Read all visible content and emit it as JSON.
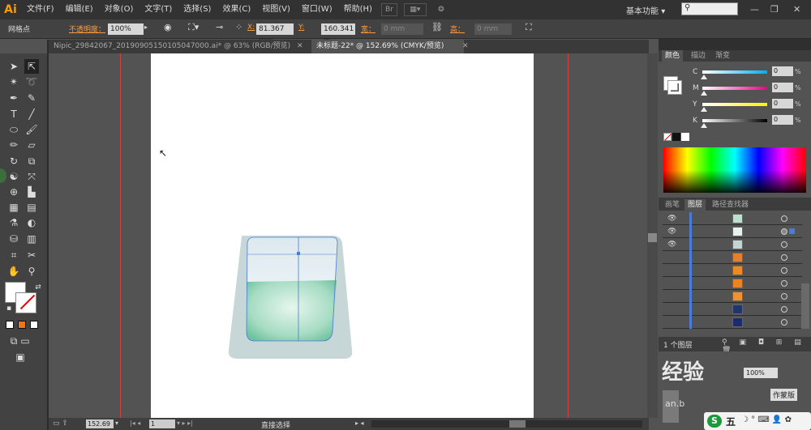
{
  "app": {
    "logo": "Ai"
  },
  "menu": [
    "文件(F)",
    "编辑(E)",
    "对象(O)",
    "文字(T)",
    "选择(S)",
    "效果(C)",
    "视图(V)",
    "窗口(W)",
    "帮助(H)"
  ],
  "menubar_extra": {
    "br": "Br",
    "workspace": "基本功能",
    "workspace_arrow": "▾"
  },
  "window_controls": [
    "—",
    "❐",
    "✕"
  ],
  "control": {
    "mode": "网格点",
    "opacity_label": "不透明度：",
    "opacity_value": "100%",
    "x_label": "X:",
    "x_value": "81.367 mm",
    "y_label": "Y:",
    "y_value": "160.341 m",
    "w_label": "宽：",
    "w_value": "0 mm",
    "h_label": "高：",
    "h_value": "0 mm"
  },
  "tabs": [
    {
      "label": "Nipic_29842067_20190905150105047000.ai* @ 63% (RGB/预览)",
      "close": "✕"
    },
    {
      "label": "未标题-22* @ 152.69% (CMYK/预览)",
      "close": "✕"
    }
  ],
  "panels": {
    "color_tabs": [
      "颜色",
      "描边",
      "渐变"
    ],
    "sliders": [
      {
        "label": "C",
        "value": "0",
        "unit": "%",
        "gradient": "linear-gradient(to right,#fff,#00aeef)"
      },
      {
        "label": "M",
        "value": "0",
        "unit": "%",
        "gradient": "linear-gradient(to right,#fff,#ec008c)"
      },
      {
        "label": "Y",
        "value": "0",
        "unit": "%",
        "gradient": "linear-gradient(to right,#fff,#fff200)"
      },
      {
        "label": "K",
        "value": "0",
        "unit": "%",
        "gradient": "linear-gradient(to right,#fff,#000)"
      }
    ],
    "layer_tabs": [
      "画笔",
      "图层",
      "路径查找器"
    ],
    "layer_count": "1 个图层",
    "watermark": "经验",
    "watermark_sub": "an.b",
    "opacity_mini": "100%",
    "mask_btn": "作蒙版"
  },
  "layers": [
    {
      "eye": true,
      "thumb": "#bfe0d0",
      "target": false
    },
    {
      "eye": true,
      "thumb": "#e6f2ee",
      "target": true
    },
    {
      "eye": true,
      "thumb": "#c5d3d3",
      "target": false
    },
    {
      "eye": false,
      "thumb": "#e08030",
      "target": false
    },
    {
      "eye": false,
      "thumb": "#f08a20",
      "target": false
    },
    {
      "eye": false,
      "thumb": "#e98328",
      "target": false
    },
    {
      "eye": false,
      "thumb": "#f39030",
      "target": false
    },
    {
      "eye": false,
      "thumb": "#22336e",
      "target": false
    },
    {
      "eye": false,
      "thumb": "#1c2c6a",
      "target": false
    }
  ],
  "status": {
    "zoom": "152.69",
    "page": "1",
    "tool": "直接选择"
  },
  "ime": {
    "label": "五",
    "icons": "☽ ° ⌨ 👤 ✿"
  },
  "colors": {
    "accent": "#ff9a00",
    "guide": "#c44444",
    "selection": "#4a7bd6"
  }
}
